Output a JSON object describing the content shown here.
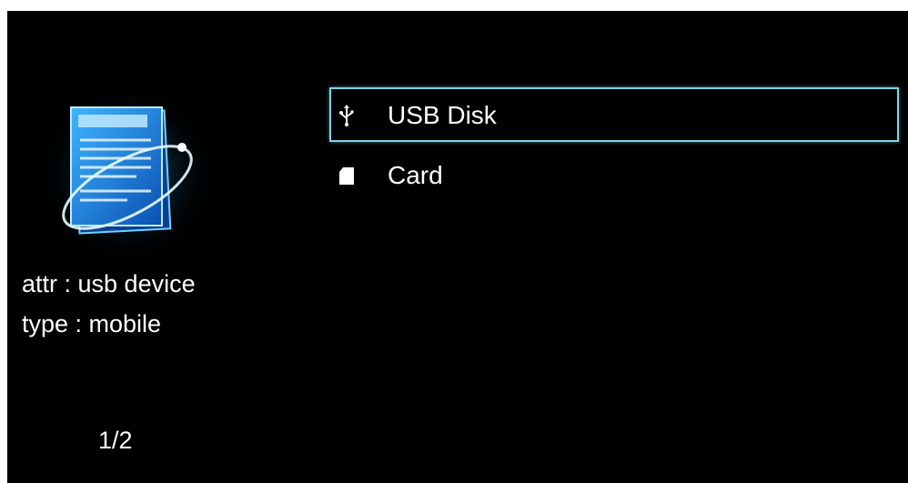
{
  "info": {
    "attr_label": "attr",
    "attr_value": "usb device",
    "type_label": "type",
    "type_value": "mobile",
    "separator": ":",
    "attr_line": "attr : usb device",
    "type_line": "type : mobile"
  },
  "page_indicator": "1/2",
  "devices": [
    {
      "label": "USB Disk",
      "icon": "usb-icon",
      "selected": true
    },
    {
      "label": "Card",
      "icon": "sd-card-icon",
      "selected": false
    }
  ],
  "colors": {
    "background": "#000000",
    "text": "#ffffff",
    "highlight_border": "#7fd3e6",
    "icon_glow": "#2aa9ff"
  }
}
